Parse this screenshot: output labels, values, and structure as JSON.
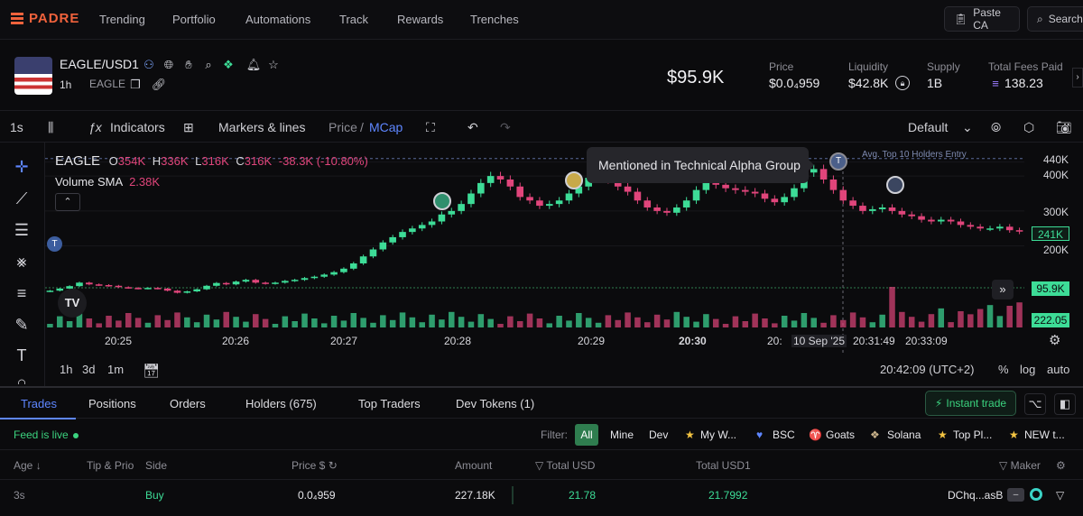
{
  "app": {
    "logo": "PADRE",
    "nav": [
      "Trending",
      "Portfolio",
      "Automations",
      "Track",
      "Rewards",
      "Trenches"
    ],
    "paste_ca": "Paste CA",
    "search": "Search"
  },
  "token": {
    "pair": "EAGLE/USD1",
    "timeframe": "1h",
    "ticker": "EAGLE",
    "market_cap": "$95.9K",
    "stats": [
      {
        "label": "Price",
        "value": "$0.0₄959"
      },
      {
        "label": "Liquidity",
        "value": "$42.8K"
      },
      {
        "label": "Supply",
        "value": "1B"
      },
      {
        "label": "Total Fees Paid",
        "value": "138.23"
      }
    ]
  },
  "chart_toolbar": {
    "interval": "1s",
    "indicators": "Indicators",
    "markers": "Markers & lines",
    "price": "Price",
    "separator": "/",
    "mcap": "MCap",
    "layout": "Default"
  },
  "chart_legend": {
    "symbol": "EAGLE",
    "o_label": "O",
    "o_value": "354K",
    "h_label": "H",
    "h_value": "336K",
    "l_label": "L",
    "l_value": "316K",
    "c_label": "C",
    "c_value": "316K",
    "change": "-38.3K (-10.80%)",
    "volume_label": "Volume SMA",
    "volume_value": "2.38K"
  },
  "chart_annotations": {
    "tooltip": "Mentioned in Technical Alpha Group",
    "line_label": "Avg. Top 10 Holders Entry"
  },
  "chart_data": {
    "type": "candlestick",
    "unit": "market cap (USD)",
    "y_ticks": [
      "440K",
      "400K",
      "300K",
      "200K"
    ],
    "x_ticks": [
      "20:25",
      "20:26",
      "20:27",
      "20:28",
      "20:29",
      "20:30",
      "20:",
      "10 Sep '25",
      "20:31:49",
      "20:33:09"
    ],
    "ylim": [
      70000,
      470000
    ],
    "current_price_tag": "241K",
    "mcap_tag": "95.9K",
    "volume_tag": "222.05",
    "close_series": [
      72000,
      78000,
      85000,
      95000,
      90000,
      88000,
      86000,
      82000,
      80000,
      78000,
      80000,
      78000,
      72000,
      66000,
      70000,
      76000,
      86000,
      94000,
      90000,
      98000,
      103000,
      95000,
      92000,
      95000,
      100000,
      103000,
      108000,
      112000,
      118000,
      125000,
      135000,
      150000,
      170000,
      190000,
      210000,
      225000,
      240000,
      250000,
      260000,
      270000,
      290000,
      300000,
      320000,
      350000,
      380000,
      400000,
      390000,
      370000,
      340000,
      330000,
      315000,
      320000,
      330000,
      350000,
      370000,
      395000,
      405000,
      390000,
      370000,
      355000,
      330000,
      310000,
      300000,
      295000,
      310000,
      330000,
      360000,
      380000,
      375000,
      365000,
      360000,
      355000,
      350000,
      335000,
      325000,
      340000,
      365000,
      410000,
      420000,
      390000,
      360000,
      330000,
      315000,
      300000,
      305000,
      310000,
      300000,
      290000,
      285000,
      275000,
      270000,
      275000,
      270000,
      260000,
      255000,
      250000,
      250000,
      255000,
      245000,
      241000
    ]
  },
  "chart_bottom": {
    "ranges": [
      "1h",
      "3d",
      "1m"
    ],
    "clock": "20:42:09 (UTC+2)",
    "percent": "%",
    "log": "log",
    "auto": "auto"
  },
  "tabs": [
    "Trades",
    "Positions",
    "Orders",
    "Holders (675)",
    "Top Traders",
    "Dev Tokens (1)"
  ],
  "instant_trade": "Instant trade",
  "filter": {
    "live": "Feed is live",
    "label": "Filter:",
    "items": [
      "All",
      "Mine",
      "Dev",
      "My W...",
      "BSC",
      "Goats",
      "Solana",
      "Top Pl...",
      "NEW t..."
    ]
  },
  "table": {
    "headers": [
      "Age",
      "Tip & Prio",
      "Side",
      "Price $",
      "Amount",
      "Total USD",
      "Total USD1",
      "Maker"
    ],
    "rows": [
      {
        "age": "3s",
        "side": "Buy",
        "price": "0.0₄959",
        "amount": "227.18K",
        "total_usd": "21.78",
        "total_usd1": "21.7992",
        "maker": "DChq...asB"
      }
    ]
  },
  "colors": {
    "up": "#3ddc97",
    "down": "#e0457b",
    "accent": "#5e86ff",
    "brand": "#f0623c"
  }
}
